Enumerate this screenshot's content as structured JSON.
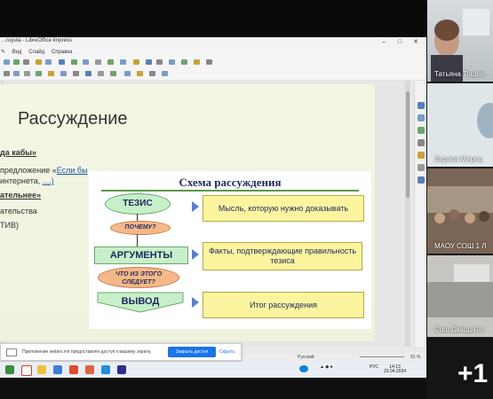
{
  "window": {
    "title": "...ruyuta - LibreOffice Impress"
  },
  "menu": [
    "Вид",
    "Слайд",
    "Справка"
  ],
  "slide": {
    "heading": "Рассуждение",
    "lines": [
      {
        "text": "да кабы»",
        "style": "bold"
      },
      {
        "prefix": "предложение «",
        "link": "Если бы",
        "style": "mixed"
      },
      {
        "prefix": "интернета, ",
        "link": "....)",
        "style": "mixed"
      },
      {
        "text": "ательнее»",
        "style": "bold"
      },
      {
        "text": "ательства",
        "style": "plain"
      },
      {
        "text": "ТИВ)",
        "style": "plain"
      }
    ]
  },
  "scheme": {
    "title": "Схема рассуждения",
    "thesis": "ТЕЗИС",
    "why": "ПОЧЕМУ?",
    "arguments": "АРГУМЕНТЫ",
    "follows_line1": "ЧТО ИЗ ЭТОГО",
    "follows_line2": "СЛЕДУЕТ?",
    "conclusion": "ВЫВОД",
    "box_thesis": "Мысль, которую нужно доказывать",
    "box_args": "Факты, подтверждающие правильность тезиса",
    "box_conclusion": "Итог рассуждения"
  },
  "statusbar": {
    "language": "Русский",
    "zoom": "91 %"
  },
  "notification": {
    "message": "Приложение webex.me предоставлен доступ к вашему экрану.",
    "share_button": "Закрыть доступ",
    "hide_button": "Скрыть"
  },
  "taskbar": {
    "time": "14:13",
    "date": "23.04.2024",
    "lang": "РУС"
  },
  "participants": [
    {
      "name": "Татьяна Тощев"
    },
    {
      "name": "Лариса Мерец"
    },
    {
      "name": "МАОУ СОШ 1 Л"
    },
    {
      "name": "Сош Двадцаты"
    }
  ],
  "more_count": "+1"
}
